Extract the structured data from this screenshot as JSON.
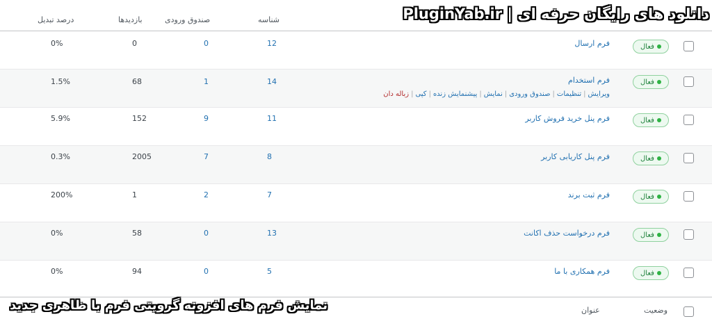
{
  "header": {
    "col_conversion": "درصد تبدیل",
    "col_views": "بازدیدها",
    "col_inbox": "صندوق ورودی",
    "col_id": "شناسه"
  },
  "banner_top": "دانلود های رایگان حرفه ای | PluginYab.ir",
  "banner_bottom": "نمایش فرم های افزونه گرویتی فرم با ظاهری جدید",
  "status_label": "فعال",
  "rows": [
    {
      "title": "فرم ارسال",
      "id": "12",
      "inbox": "0",
      "views": "0",
      "conversion": "0%"
    },
    {
      "title": "فرم استخدام",
      "id": "14",
      "inbox": "1",
      "views": "68",
      "conversion": "1.5%"
    },
    {
      "title": "فرم پنل خرید فروش کاربر",
      "id": "11",
      "inbox": "9",
      "views": "152",
      "conversion": "5.9%"
    },
    {
      "title": "فرم پنل کاریابی کاربر",
      "id": "8",
      "inbox": "7",
      "views": "2005",
      "conversion": "0.3%"
    },
    {
      "title": "فرم ثبت برند",
      "id": "7",
      "inbox": "2",
      "views": "1",
      "conversion": "200%"
    },
    {
      "title": "فرم درخواست حذف اکانت",
      "id": "13",
      "inbox": "0",
      "views": "58",
      "conversion": "0%"
    },
    {
      "title": "فرم همکاری با ما",
      "id": "5",
      "inbox": "0",
      "views": "94",
      "conversion": "0%"
    }
  ],
  "row_actions": {
    "edit": "ویرایش",
    "settings": "تنظیمات",
    "inbox": "صندوق ورودی",
    "preview": "نمایش",
    "live_preview": "پیشنمایش زنده",
    "copy": "کپی",
    "trash": "زباله دان"
  },
  "footer": {
    "col_status": "وضعیت",
    "col_title": "عنوان"
  }
}
